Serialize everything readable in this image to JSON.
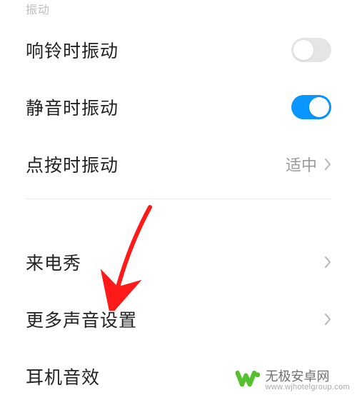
{
  "section": {
    "title": "振动"
  },
  "rows": {
    "vibrate_on_ring": {
      "label": "响铃时振动",
      "enabled": false
    },
    "vibrate_on_silent": {
      "label": "静音时振动",
      "enabled": true
    },
    "vibrate_on_tap": {
      "label": "点按时振动",
      "value": "适中"
    },
    "caller_show": {
      "label": "来电秀"
    },
    "more_sound": {
      "label": "更多声音设置"
    },
    "headphone_fx": {
      "label": "耳机音效"
    }
  },
  "colors": {
    "toggle_on": "#0b95ff",
    "toggle_off": "#e5e5e5",
    "chevron": "#bcbcbc",
    "arrow": "#ff1a1a",
    "logo_green": "#55c12e"
  },
  "watermark": {
    "title": "无极安卓网",
    "url": "www.wjhotelgroup.com"
  }
}
